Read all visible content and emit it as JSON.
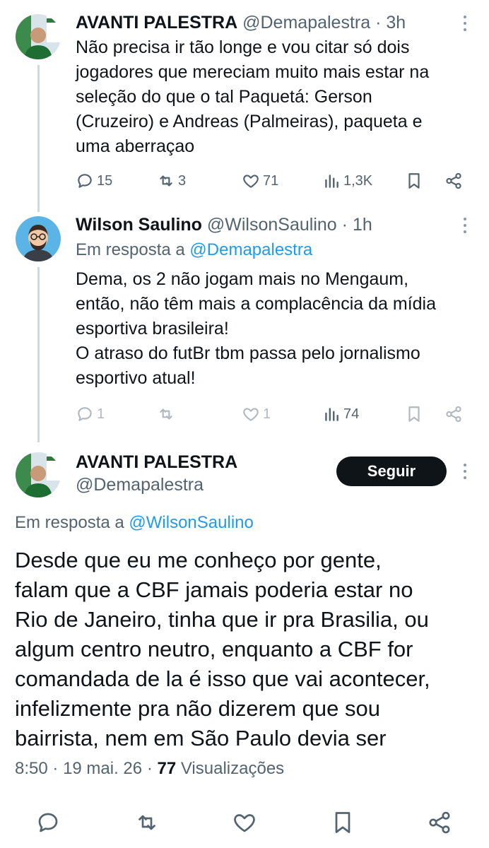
{
  "tweets": [
    {
      "name": "AVANTI PALESTRA",
      "handle": "@Demapalestra",
      "time": "3h",
      "lines": [
        "Não precisa ir tão longe e vou citar só dois",
        "jogadores que mereciam muito mais estar na",
        "seleção do que o tal Paquetá: Gerson",
        "(Cruzeiro) e Andreas (Palmeiras), paqueta e",
        "uma aberraçao"
      ],
      "stats": {
        "replies": "15",
        "retweets": "3",
        "likes": "71",
        "views": "1,3K"
      }
    },
    {
      "name": "Wilson Saulino",
      "handle": "@WilsonSaulino",
      "time": "1h",
      "reply_prefix": "Em resposta a",
      "reply_mention": "@Demapalestra",
      "lines": [
        "Dema, os 2 não jogam mais no Mengaum,",
        "então, não têm mais a complacência da mídia",
        "esportiva brasileira!",
        "O atraso do futBr tbm passa pelo jornalismo",
        "esportivo atual!"
      ],
      "stats": {
        "replies": "1",
        "retweets": "",
        "likes": "1",
        "views": "74"
      }
    }
  ],
  "main": {
    "name": "AVANTI PALESTRA",
    "handle": "@Demapalestra",
    "follow_label": "Seguir",
    "reply_prefix": "Em resposta a",
    "reply_mention": "@WilsonSaulino",
    "lines": [
      "Desde que eu me conheço por gente,",
      "falam que a CBF jamais poderia estar no",
      "Rio de Janeiro, tinha que ir pra Brasilia, ou",
      "algum centro neutro, enquanto a CBF for",
      "comandada de la é isso que vai acontecer,",
      "infelizmente pra não dizerem que sou",
      "bairrista, nem em São Paulo devia ser"
    ],
    "time": "8:50",
    "date": "19 mai. 26",
    "views_count": "77",
    "views_label": "Visualizações"
  },
  "sep": "·",
  "icons": {
    "reply": "reply-icon",
    "retweet": "retweet-icon",
    "like": "heart-icon",
    "views": "views-chart-icon",
    "bookmark": "bookmark-icon",
    "share": "share-icon",
    "more": "more-vertical-icon"
  },
  "colors": {
    "text": "#0f1419",
    "muted": "#536471",
    "link": "#1d9bf0",
    "thread_line": "#cfd9de",
    "button_bg": "#0f1419"
  }
}
